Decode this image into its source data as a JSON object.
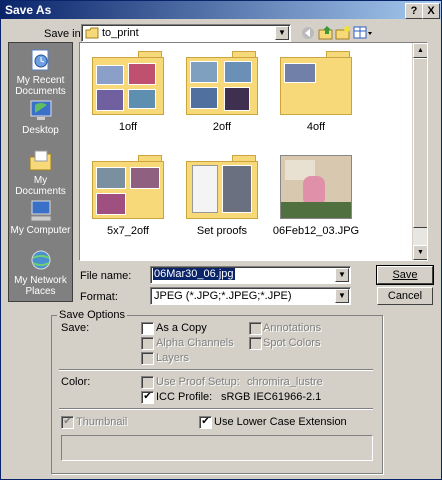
{
  "window": {
    "title": "Save As",
    "help_label": "?",
    "close_label": "X"
  },
  "save_in": {
    "label": "Save in:",
    "value": "to_print"
  },
  "places": [
    {
      "label": "My Recent Documents",
      "icon": "recent-documents-icon"
    },
    {
      "label": "Desktop",
      "icon": "desktop-icon"
    },
    {
      "label": "My Documents",
      "icon": "my-documents-icon"
    },
    {
      "label": "My Computer",
      "icon": "my-computer-icon"
    },
    {
      "label": "My Network Places",
      "icon": "network-places-icon"
    }
  ],
  "files": [
    {
      "name": "1off",
      "type": "folder"
    },
    {
      "name": "2off",
      "type": "folder"
    },
    {
      "name": "4off",
      "type": "folder"
    },
    {
      "name": "5x7_2off",
      "type": "folder"
    },
    {
      "name": "Set proofs",
      "type": "folder"
    },
    {
      "name": "06Feb12_03.JPG",
      "type": "image"
    }
  ],
  "file_name": {
    "label": "File name:",
    "value": "06Mar30_06.jpg"
  },
  "format": {
    "label": "Format:",
    "value": "JPEG (*.JPG;*.JPEG;*.JPE)"
  },
  "buttons": {
    "save": "Save",
    "cancel": "Cancel"
  },
  "save_options": {
    "title": "Save Options",
    "save_label": "Save:",
    "as_a_copy": "As a Copy",
    "alpha_channels": "Alpha Channels",
    "layers": "Layers",
    "annotations": "Annotations",
    "spot_colors": "Spot Colors",
    "color_label": "Color:",
    "use_proof_setup": "Use Proof Setup:",
    "proof_value": "chromira_lustre",
    "icc_profile": "ICC Profile:",
    "icc_value": "sRGB IEC61966-2.1",
    "thumbnail": "Thumbnail",
    "lower_case_ext": "Use Lower Case Extension"
  },
  "colors": {
    "title_start": "#0a246a",
    "title_end": "#a6caf0",
    "face": "#d4d0c8",
    "selection": "#0a246a"
  }
}
